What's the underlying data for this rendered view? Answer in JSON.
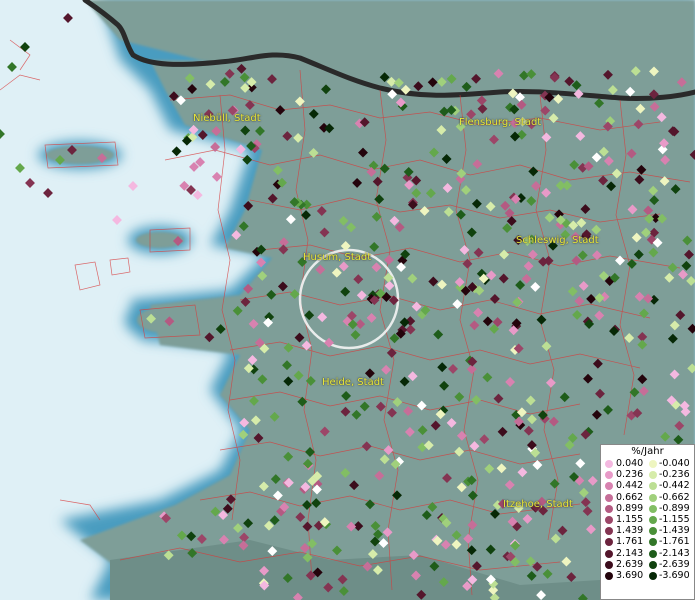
{
  "legend": {
    "title": "%/Jahr",
    "positive": [
      {
        "label": "0.040",
        "color": "#f4b8e0"
      },
      {
        "label": "0.236",
        "color": "#e89ac8"
      },
      {
        "label": "0.442",
        "color": "#d882b0"
      },
      {
        "label": "0.662",
        "color": "#c66e98"
      },
      {
        "label": "0.899",
        "color": "#b45a82"
      },
      {
        "label": "1.155",
        "color": "#9c4668"
      },
      {
        "label": "1.439",
        "color": "#843452"
      },
      {
        "label": "1.761",
        "color": "#6c243e"
      },
      {
        "label": "2.143",
        "color": "#54162c"
      },
      {
        "label": "2.639",
        "color": "#3c0c1c"
      },
      {
        "label": "3.690",
        "color": "#24040c"
      }
    ],
    "negative": [
      {
        "label": "-0.040",
        "color": "#eef5c0"
      },
      {
        "label": "-0.236",
        "color": "#d6ecaa"
      },
      {
        "label": "-0.442",
        "color": "#bcdf94"
      },
      {
        "label": "-0.662",
        "color": "#a0d07c"
      },
      {
        "label": "-0.899",
        "color": "#82be64"
      },
      {
        "label": "-1.155",
        "color": "#64a84c"
      },
      {
        "label": "-1.439",
        "color": "#4a9038"
      },
      {
        "label": "-1.761",
        "color": "#327628"
      },
      {
        "label": "-2.143",
        "color": "#1e5c1a"
      },
      {
        "label": "-2.639",
        "color": "#10420e"
      },
      {
        "label": "-3.690",
        "color": "#062806"
      }
    ]
  },
  "cities": [
    {
      "key": "niebuell",
      "label": "Niebüll, Stadt"
    },
    {
      "key": "flensburg",
      "label": "Flensburg, Stadt"
    },
    {
      "key": "schleswig",
      "label": "Schleswig, Stadt"
    },
    {
      "key": "husum",
      "label": "Husum, Stadt"
    },
    {
      "key": "heide",
      "label": "Heide, Stadt"
    },
    {
      "key": "itzehoe",
      "label": "Itzehoe, Stadt"
    }
  ],
  "colors": {
    "land": "#7e9e98",
    "sea": "#dff0f6",
    "coast_glow": "#4a9cc0",
    "boundary": "#d83a3a",
    "border_line": "#2a2a2a",
    "city_label": "#e8e83a"
  }
}
